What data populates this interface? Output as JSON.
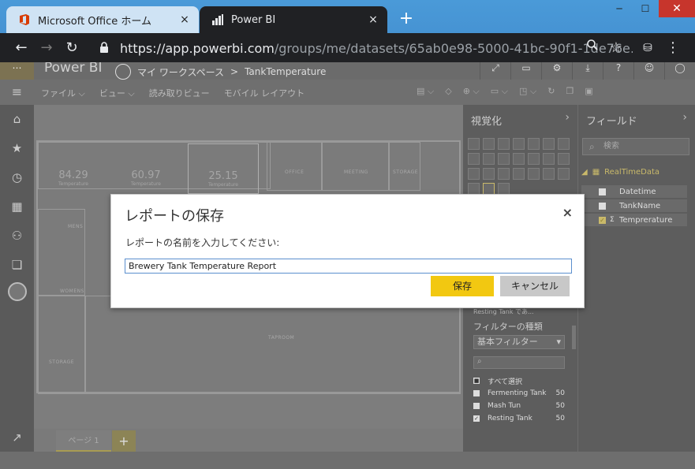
{
  "browser": {
    "tabs": [
      {
        "title": "Microsoft Office ホーム",
        "close": "×"
      },
      {
        "title": "Power BI",
        "close": "×"
      }
    ],
    "new_tab": "+",
    "window": {
      "min": "─",
      "max": "☐",
      "close": "✕"
    },
    "back": "←",
    "forward": "→",
    "reload": "↻",
    "address": {
      "host": "https://app.powerbi.com",
      "path": "/groups/me/datasets/65ab0e98-5000-41bc-90f1-1de76e…"
    },
    "toolbar_icons": [
      "search-icon",
      "star-icon",
      "cast-icon",
      "menu-icon"
    ]
  },
  "pbi": {
    "brand": "Power BI",
    "workspace": "マイ ワークスペース",
    "separator": ">",
    "dataset": "TankTemperature"
  },
  "menu": {
    "items": [
      "ファイル ⌵",
      "ビュー ⌵",
      "読み取りビュー",
      "モバイル レイアウト"
    ]
  },
  "report": {
    "kpis": [
      {
        "value": "84.29",
        "label": "Temperature"
      },
      {
        "value": "60.97",
        "label": "Temperature"
      },
      {
        "value": "25.15",
        "label": "Temperature"
      }
    ],
    "rooms": [
      "OFFICE",
      "MEETING",
      "STORAGE",
      "MENS",
      "WOMENS",
      "TAPROOM",
      "STORAGE"
    ],
    "page_tab": "ページ 1",
    "add_page": "+"
  },
  "viz_pane": {
    "title": "視覚化",
    "filter_field": "Resting Tank  であ...",
    "filter_type_label": "フィルターの種類",
    "filter_type_value": "基本フィルター",
    "filter_items": [
      {
        "name": "すべて選択",
        "count": "",
        "checked": "■"
      },
      {
        "name": "Fermenting Tank",
        "count": "50",
        "checked": ""
      },
      {
        "name": "Mash Tun",
        "count": "50",
        "checked": ""
      },
      {
        "name": "Resting Tank",
        "count": "50",
        "checked": "✓"
      }
    ]
  },
  "field_pane": {
    "title": "フィールド",
    "search_placeholder": "検索",
    "table": "RealTimeData",
    "fields": [
      {
        "name": "Datetime",
        "checked": ""
      },
      {
        "name": "TankName",
        "checked": ""
      },
      {
        "name": "Tempreraturе",
        "checked": "✓"
      }
    ]
  },
  "dialog": {
    "title": "レポートの保存",
    "close": "×",
    "prompt": "レポートの名前を入力してください:",
    "value": "Brewery Tank Temperature Report",
    "save": "保存",
    "cancel": "キャンセル"
  },
  "colors": {
    "accent": "#f2c811",
    "tab_active": "#202124",
    "titlebar": "#4693d3"
  }
}
